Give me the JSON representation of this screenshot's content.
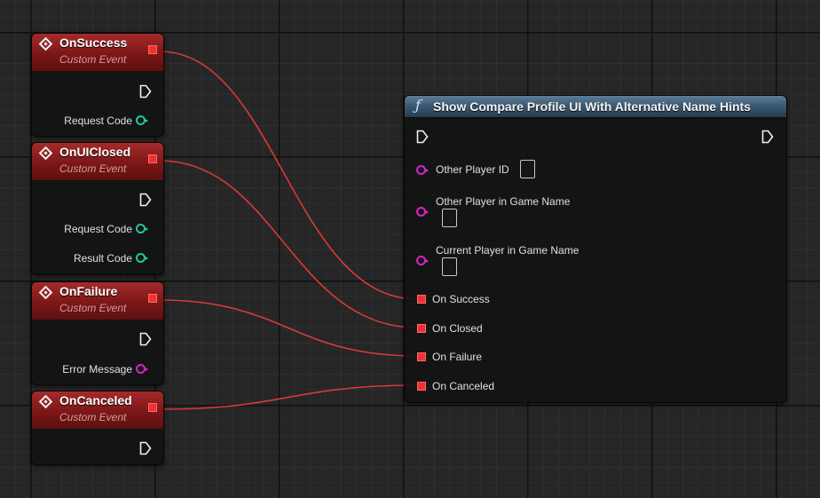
{
  "events": [
    {
      "title": "OnSuccess",
      "subtitle": "Custom Event",
      "outputs": [
        "Request Code"
      ]
    },
    {
      "title": "OnUIClosed",
      "subtitle": "Custom Event",
      "outputs": [
        "Request Code",
        "Result Code"
      ]
    },
    {
      "title": "OnFailure",
      "subtitle": "Custom Event",
      "outputs": [
        "Error Message"
      ]
    },
    {
      "title": "OnCanceled",
      "subtitle": "Custom Event",
      "outputs": []
    }
  ],
  "function_node": {
    "icon": "function-icon",
    "title": "Show Compare Profile UI With Alternative Name Hints",
    "inputs": [
      "Other Player ID",
      "Other Player in Game Name",
      "Current Player in Game Name"
    ],
    "delegates": [
      "On Success",
      "On Closed",
      "On Failure",
      "On Canceled"
    ]
  },
  "colors": {
    "event_header": "#8a1f1f",
    "function_header": "#3d5a73",
    "delegate_pin": "#ee3232",
    "wire": "#d83a3a",
    "int_pin": "#1ec8a0",
    "string_pin": "#d822c8"
  }
}
